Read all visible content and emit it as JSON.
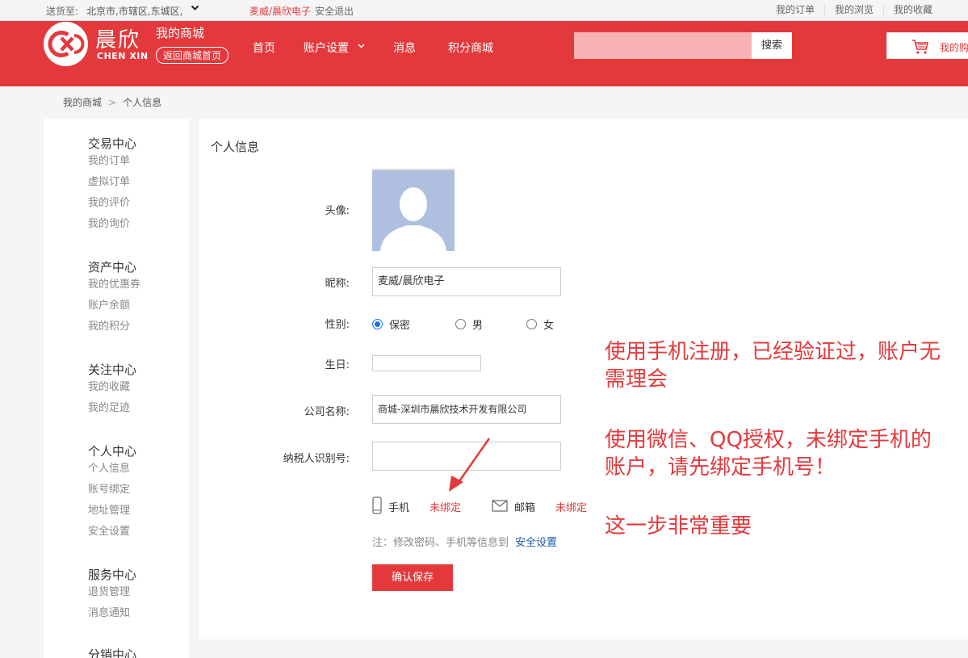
{
  "topbar": {
    "deliver_label": "送货至:",
    "deliver_value": "北京市,市辖区,东城区,",
    "user_name": "麦威/晨欣电子",
    "logout": "安全退出",
    "links": [
      "我的订单",
      "我的浏览",
      "我的收藏"
    ]
  },
  "header": {
    "logo_cn": "晨欣",
    "logo_en": "CHEN XIN",
    "mall_title": "我的商城",
    "back_home": "返回商城首页",
    "nav": [
      "首页",
      "账户设置",
      "消息",
      "积分商城"
    ],
    "search_placeholder": "",
    "search_button": "搜索",
    "cart_text": "我的购"
  },
  "breadcrumb": [
    "我的商城",
    "个人信息"
  ],
  "sidebar": {
    "groups": [
      {
        "title": "交易中心",
        "items": [
          "我的订单",
          "虚拟订单",
          "我的评价",
          "我的询价"
        ]
      },
      {
        "title": "资产中心",
        "items": [
          "我的优惠券",
          "账户余额",
          "我的积分"
        ]
      },
      {
        "title": "关注中心",
        "items": [
          "我的收藏",
          "我的足迹"
        ]
      },
      {
        "title": "个人中心",
        "items": [
          "个人信息",
          "账号绑定",
          "地址管理",
          "安全设置"
        ]
      },
      {
        "title": "服务中心",
        "items": [
          "退货管理",
          "消息通知"
        ]
      },
      {
        "title": "分销中心",
        "items": []
      }
    ]
  },
  "form": {
    "title": "个人信息",
    "avatar_label": "头像:",
    "nickname_label": "昵称:",
    "nickname_value": "麦威/晨欣电子",
    "gender_label": "性别:",
    "gender_options": [
      "保密",
      "男",
      "女"
    ],
    "gender_selected": "保密",
    "birthday_label": "生日:",
    "birthday_value": "",
    "company_label": "公司名称:",
    "company_value": "商城-深圳市晨欣技术开发有限公司",
    "tax_label": "纳税人识别号:",
    "tax_value": "",
    "phone_label": "手机",
    "phone_status": "未绑定",
    "email_label": "邮箱",
    "email_status": "未绑定",
    "note_text": "注：修改密码、手机等信息到",
    "note_link": "安全设置",
    "save_button": "确认保存"
  },
  "annotations": [
    "使用手机注册，已经验证过，账户无\n需理会",
    "使用微信、QQ授权，未绑定手机的\n账户，请先绑定手机号！",
    "这一步非常重要"
  ],
  "colors": {
    "brand_red": "#e4393c",
    "link_blue": "#1a5ea8",
    "radio_blue": "#1a73e8"
  }
}
